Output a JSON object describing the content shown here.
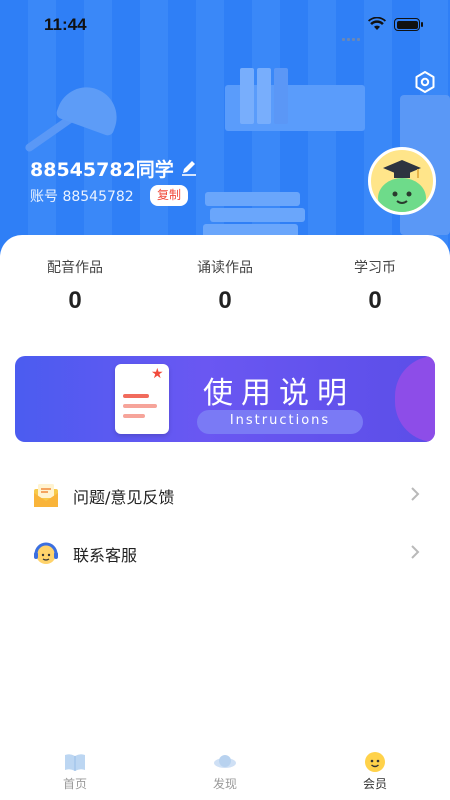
{
  "status_bar": {
    "time": "11:44"
  },
  "profile": {
    "username": "88545782同学",
    "account_label": "账号 88545782",
    "copy_label": "复制"
  },
  "stats": [
    {
      "label": "配音作品",
      "value": "0"
    },
    {
      "label": "诵读作品",
      "value": "0"
    },
    {
      "label": "学习币",
      "value": "0"
    }
  ],
  "banner": {
    "title": "使用说明",
    "subtitle": "Instructions"
  },
  "menu": [
    {
      "label": "问题/意见反馈",
      "icon": "feedback-envelope-icon"
    },
    {
      "label": "联系客服",
      "icon": "customer-service-headset-icon"
    }
  ],
  "tabbar": [
    {
      "label": "首页",
      "icon": "book-home-icon",
      "active": false
    },
    {
      "label": "发现",
      "icon": "planet-discover-icon",
      "active": false
    },
    {
      "label": "会员",
      "icon": "smiley-member-icon",
      "active": true
    }
  ],
  "colors": {
    "primary": "#2f7ff6",
    "copy_text": "#f04a3b",
    "banner": "#5b5cf0"
  }
}
